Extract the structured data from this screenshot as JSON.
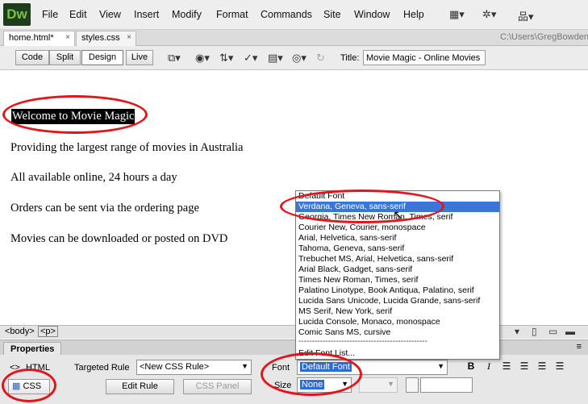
{
  "app": {
    "logo": "Dw"
  },
  "menu": [
    "File",
    "Edit",
    "View",
    "Insert",
    "Modify",
    "Format",
    "Commands",
    "Site",
    "Window",
    "Help"
  ],
  "menu_icons": [
    "layout-icon",
    "gear-icon",
    "sitemap-icon"
  ],
  "tabs": [
    {
      "label": "home.html*",
      "close": "×"
    },
    {
      "label": "styles.css",
      "close": "×"
    }
  ],
  "file_path": "C:\\Users\\GregBowden",
  "view_buttons": [
    "Code",
    "Split",
    "Design",
    "Live"
  ],
  "title_label": "Title:",
  "title_value": "Movie Magic - Online Movies",
  "document": {
    "heading": "Welcome to Movie Magic",
    "paragraphs": [
      "Providing the largest range of movies in Australia",
      "All available online, 24 hours a day",
      "Orders can be sent via the ordering page",
      "Movies can be downloaded or posted on DVD"
    ]
  },
  "tag_selector": [
    "<body>",
    "<p>"
  ],
  "properties": {
    "tab_label": "Properties",
    "html_label": "HTML",
    "css_label": "CSS",
    "targeted_rule_label": "Targeted Rule",
    "targeted_rule_value": "<New CSS Rule>",
    "edit_rule_label": "Edit Rule",
    "css_panel_label": "CSS Panel",
    "font_label": "Font",
    "font_value": "Default Font",
    "size_label": "Size",
    "size_value": "None"
  },
  "font_list": {
    "options": [
      "Default Font",
      "Verdana, Geneva, sans-serif",
      "Georgia, Times New Roman, Times, serif",
      "Courier New, Courier, monospace",
      "Arial, Helvetica, sans-serif",
      "Tahoma, Geneva, sans-serif",
      "Trebuchet MS, Arial, Helvetica, sans-serif",
      "Arial Black, Gadget, sans-serif",
      "Times New Roman, Times, serif",
      "Palatino Linotype, Book Antiqua, Palatino, serif",
      "Lucida Sans Unicode, Lucida Grande, sans-serif",
      "MS Serif, New York, serif",
      "Lucida Console, Monaco, monospace",
      "Comic Sans MS, cursive"
    ],
    "separator": "------------------------------------------------",
    "edit": "Edit Font List..."
  },
  "colors": {
    "annotation": "#e3141a",
    "highlight": "#3677d8",
    "logo_bg": "#1f3c1c",
    "logo_fg": "#7bc142"
  }
}
